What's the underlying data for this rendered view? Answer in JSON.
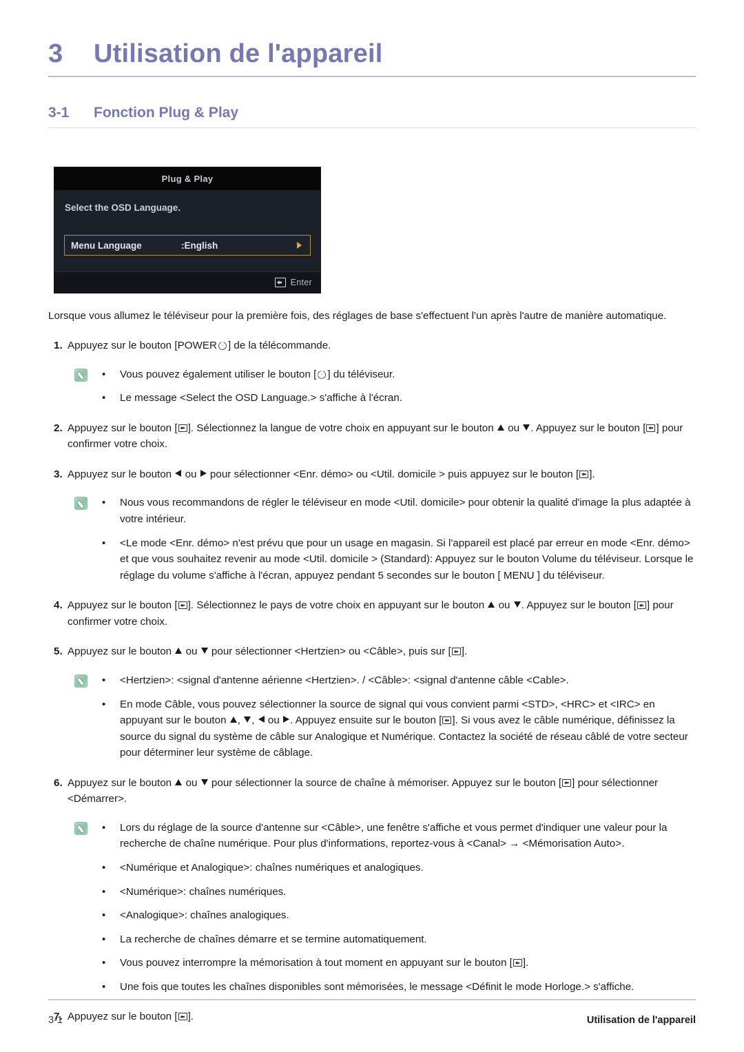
{
  "chapter": {
    "number": "3",
    "title": "Utilisation de l'appareil"
  },
  "section": {
    "number": "3-1",
    "title": "Fonction Plug & Play"
  },
  "osd": {
    "title": "Plug & Play",
    "prompt": "Select the OSD Language.",
    "row_label": "Menu Language",
    "row_value": ":English",
    "enter_label": "Enter",
    "highlight_color": "#bb8b37",
    "arrow_color": "#e8a33d",
    "background_color": "#1c2029"
  },
  "intro": "Lorsque vous allumez le téléviseur pour la première fois, des réglages de base s'effectuent l'un après l'autre de manière automatique.",
  "steps": [
    {
      "number": "1.",
      "text_before": "Appuyez sur le bouton [POWER",
      "text_after": "] de la télécommande.",
      "glyph": "power-icon"
    },
    {
      "number": "2.",
      "seg1": "Appuyez sur le bouton [",
      "seg2": "]. Sélectionnez la langue de votre choix en appuyant sur le bouton ",
      "seg3": " ou ",
      "seg4": ". Appuyez sur le bouton [",
      "seg5": "] pour confirmer votre choix."
    },
    {
      "number": "3.",
      "seg1": "Appuyez sur le bouton ",
      "seg2": " ou ",
      "seg3": " pour sélectionner <Enr. démo> ou <Util. domicile > puis appuyez sur le bouton [",
      "seg4": "]."
    },
    {
      "number": "4.",
      "seg1": "Appuyez sur le bouton [",
      "seg2": "]. Sélectionnez le pays de votre choix en appuyant sur le bouton ",
      "seg3": " ou ",
      "seg4": ". Appuyez sur le bouton [",
      "seg5": "] pour confirmer votre choix."
    },
    {
      "number": "5.",
      "seg1": "Appuyez sur le bouton ",
      "seg2": " ou ",
      "seg3": " pour sélectionner <Hertzien> ou <Câble>, puis sur [",
      "seg4": "]."
    },
    {
      "number": "6.",
      "seg1": "Appuyez sur le bouton ",
      "seg2": " ou ",
      "seg3": " pour sélectionner la source de chaîne à mémoriser. Appuyez sur le bouton [",
      "seg4": "] pour sélectionner <Démarrer>."
    },
    {
      "number": "7.",
      "seg1": "Appuyez sur le bouton [",
      "seg2": "]."
    }
  ],
  "notes_1": {
    "bullet_marker": "•",
    "items": [
      {
        "before": "Vous pouvez également utiliser le bouton [",
        "after": "] du téléviseur.",
        "glyph": "power-icon"
      },
      {
        "full": "Le message <Select the OSD Language.> s'affiche à l'écran."
      }
    ]
  },
  "notes_3": {
    "bullet_marker": "•",
    "items": [
      {
        "full": "Nous vous recommandons de régler le téléviseur en mode <Util. domicile> pour obtenir la qualité d'image la plus adaptée à votre intérieur."
      },
      {
        "full": "<Le mode <Enr. démo> n'est prévu que pour un usage en magasin. Si l'appareil est placé par erreur en mode <Enr. démo> et que vous souhaitez revenir au mode <Util. domicile > (Standard): Appuyez sur le bouton Volume du téléviseur. Lorsque le réglage du volume s'affiche à l'écran, appuyez pendant 5 secondes sur le bouton [ MENU ] du téléviseur."
      }
    ]
  },
  "notes_5": {
    "bullet_marker": "•",
    "items": [
      {
        "full": "<Hertzien>: <signal d'antenne aérienne <Hertzien>. / <Câble>: <signal d'antenne câble <Cable>."
      },
      {
        "seg1": "En mode Câble, vous pouvez sélectionner la source de signal qui vous convient parmi <STD>, <HRC> et <IRC> en appuyant sur le bouton ",
        "seg2": ", ",
        "seg3": ", ",
        "seg4": " ou ",
        "seg5": ". Appuyez ensuite sur le bouton [",
        "seg6": "]. Si vous avez le câble numérique, définissez la source du signal du système de câble sur Analogique et Numérique. Contactez la société de réseau câblé de votre secteur pour déterminer leur système de câblage."
      }
    ]
  },
  "notes_6": {
    "bullet_marker": "•",
    "items": [
      {
        "full": "Lors du réglage de la source d'antenne sur <Câble>, une fenêtre s'affiche et vous permet d'indiquer une valeur pour la recherche de chaîne numérique. Pour plus d'informations, reportez-vous à <Canal> → <Mémorisation Auto>."
      },
      {
        "full": "<Numérique et Analogique>: chaînes numériques et analogiques."
      },
      {
        "full": "<Numérique>: chaînes numériques."
      },
      {
        "full": "<Analogique>: chaînes analogiques."
      },
      {
        "full": "La recherche de chaînes démarre et se termine automatiquement."
      },
      {
        "before": "Vous pouvez interrompre la mémorisation à tout moment en appuyant sur le bouton [",
        "after": "].",
        "glyph": "enter-icon"
      },
      {
        "full": "Une fois que toutes les chaînes disponibles sont mémorisées, le message <Définit le mode Horloge.> s'affiche."
      }
    ]
  },
  "footer": {
    "left": "3-1",
    "right": "Utilisation de l'appareil"
  },
  "theme": {
    "heading_color": "#7678b0",
    "rule_color": "#b9bad6",
    "text_color": "#1c1c1c"
  }
}
